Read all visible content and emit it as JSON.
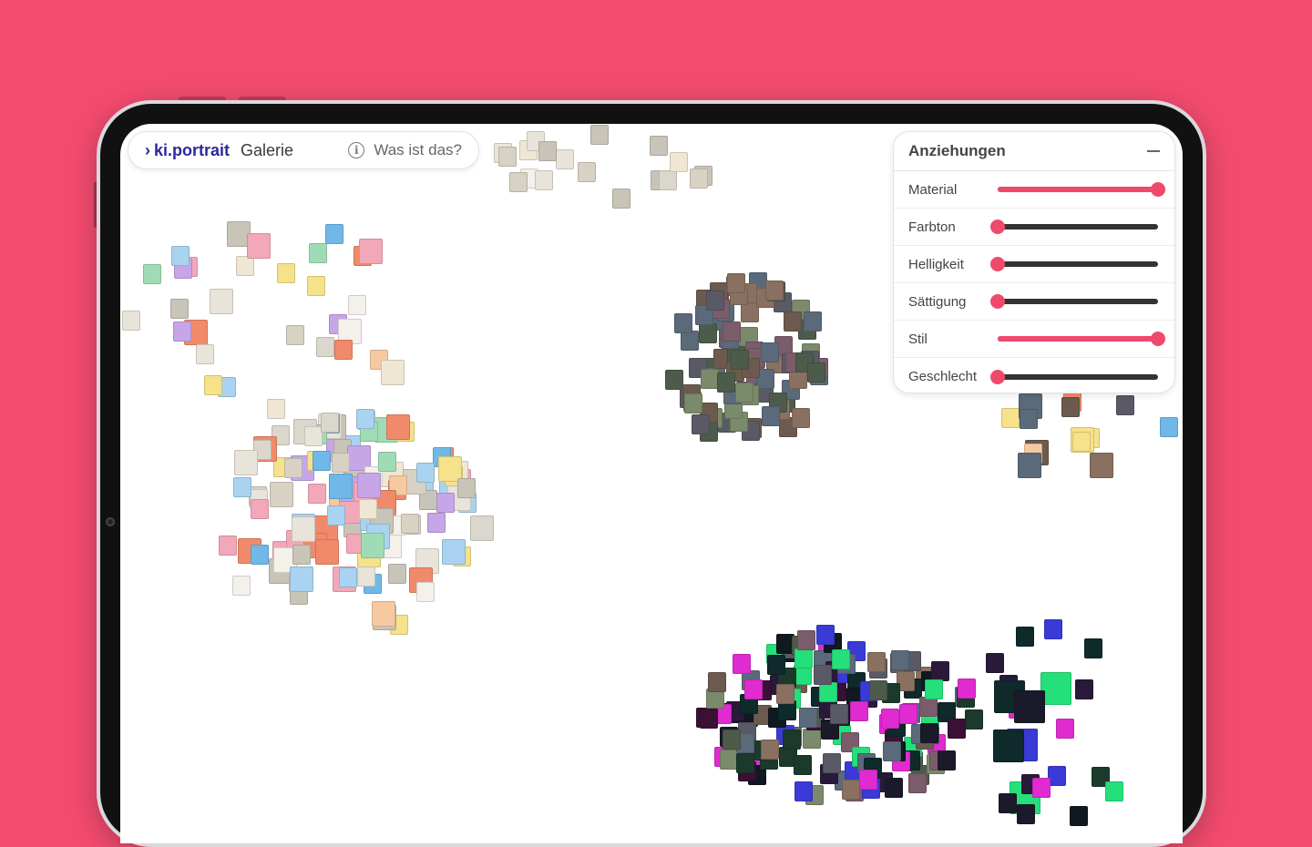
{
  "nav": {
    "brand": "ki.portrait",
    "gallery": "Galerie",
    "help": "Was ist das?"
  },
  "panel": {
    "title": "Anziehungen",
    "sliders": [
      {
        "label": "Material",
        "value": 1.0
      },
      {
        "label": "Farbton",
        "value": 0.0
      },
      {
        "label": "Helligkeit",
        "value": 0.0
      },
      {
        "label": "Sättigung",
        "value": 0.0
      },
      {
        "label": "Stil",
        "value": 1.0
      },
      {
        "label": "Geschlecht",
        "value": 0.0
      }
    ]
  },
  "colors": {
    "background": "#f24b6e",
    "accent": "#ef4a6b",
    "brand": "#2a2a9a"
  },
  "icons": {
    "brand_chevron": "chevron-right-icon",
    "help": "info-icon",
    "collapse": "minus-icon"
  }
}
